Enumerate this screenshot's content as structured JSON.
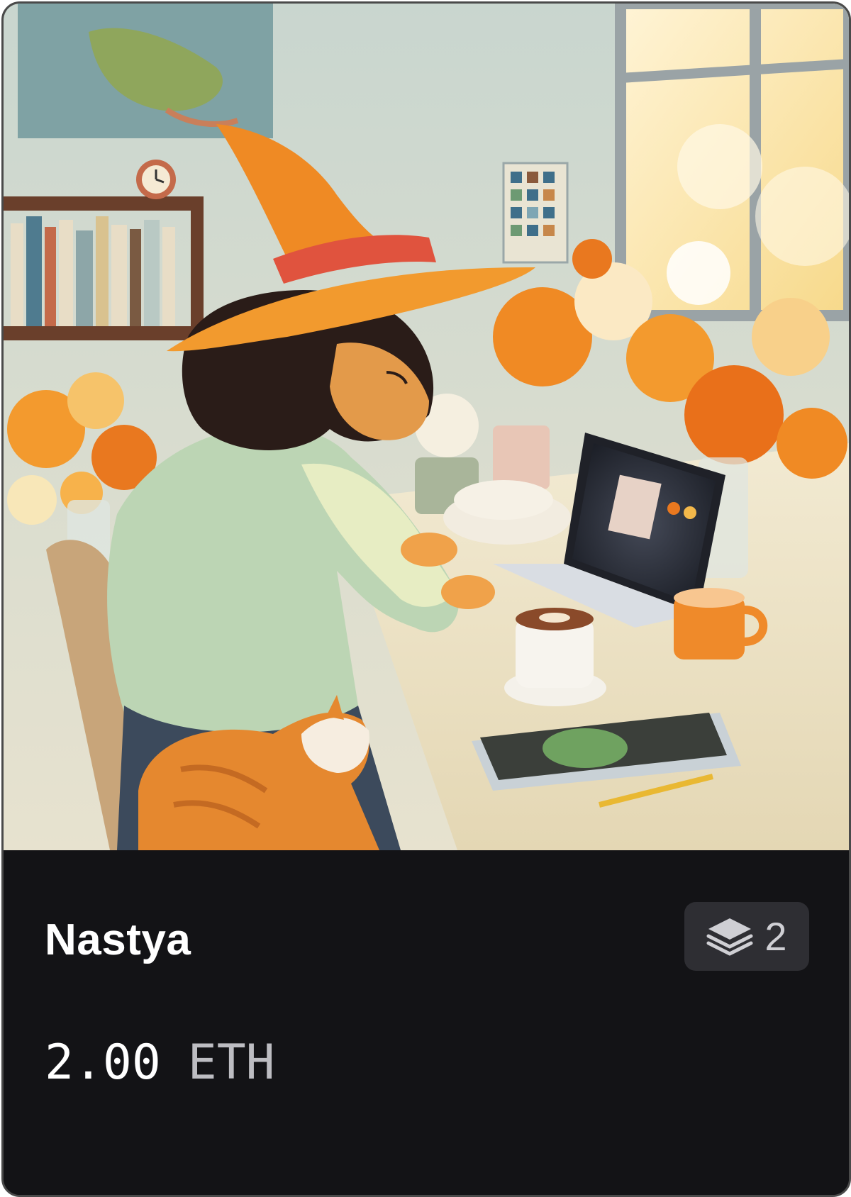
{
  "card": {
    "title": "Nastya",
    "editions": {
      "icon": "layers-icon",
      "count": "2"
    },
    "price": {
      "amount": "2.00",
      "currency": "ETH"
    },
    "artwork": {
      "icon": "artwork-image"
    }
  },
  "colors": {
    "card_background": "#131316",
    "badge_background": "#2e2e33",
    "title_text": "#ffffff",
    "currency_text": "#bdbdc2"
  }
}
